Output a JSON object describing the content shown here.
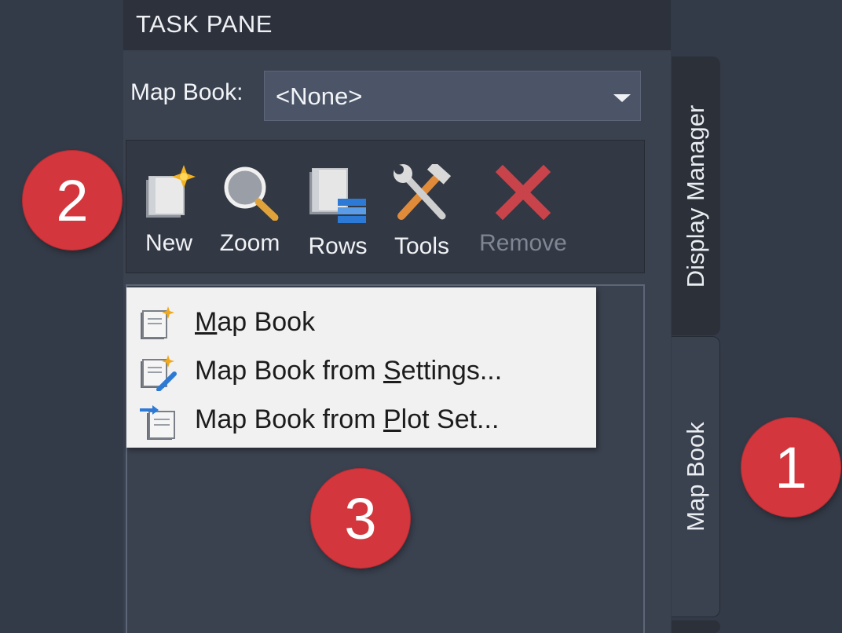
{
  "header": {
    "title": "TASK PANE"
  },
  "map_book_selector": {
    "label": "Map Book:",
    "value": "<None>"
  },
  "toolbar": {
    "new_label": "New",
    "zoom_label": "Zoom",
    "rows_label": "Rows",
    "tools_label": "Tools",
    "remove_label": "Remove"
  },
  "menu": {
    "items": [
      {
        "pre": "",
        "key": "M",
        "post": "ap Book",
        "icon": "map-book-new-icon"
      },
      {
        "pre": "Map Book from ",
        "key": "S",
        "post": "ettings...",
        "icon": "map-book-settings-icon"
      },
      {
        "pre": "Map Book from ",
        "key": "P",
        "post": "lot Set...",
        "icon": "map-book-plotset-icon"
      }
    ]
  },
  "tabs": {
    "display_manager": "Display Manager",
    "map_book": "Map Book"
  },
  "callouts": {
    "one": "1",
    "two": "2",
    "three": "3"
  },
  "colors": {
    "background": "#343b48",
    "pane": "#3a414f",
    "menu_background": "#f1f1f1",
    "callout": "#d3373d",
    "remove_icon": "#c9444a"
  }
}
